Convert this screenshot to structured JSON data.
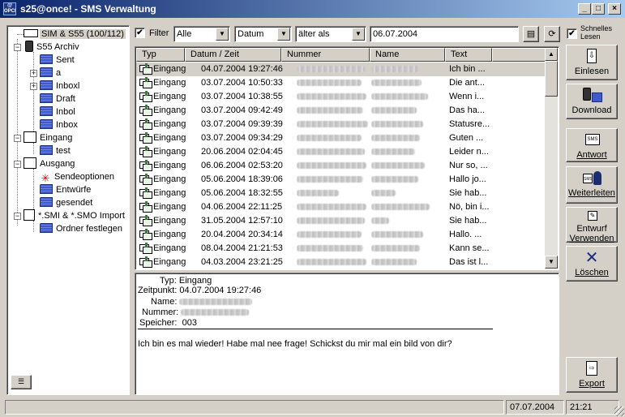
{
  "window": {
    "title": "s25@once!  -  SMS Verwaltung",
    "app_icon_text": "@ OPCE!",
    "minimize": "_",
    "maximize": "□",
    "close": "×"
  },
  "tree": {
    "items": [
      {
        "label": "SIM & S55 (100/112)",
        "icon": "sim-card-icon",
        "selected": true
      },
      {
        "label": "S55 Archiv",
        "icon": "phone-icon",
        "expander": "−"
      },
      {
        "label": "Sent",
        "icon": "folder-icon"
      },
      {
        "label": "a",
        "icon": "folder-icon",
        "expander": "+"
      },
      {
        "label": "Inboxl",
        "icon": "folder-icon",
        "expander": "+"
      },
      {
        "label": "Draft",
        "icon": "folder-icon"
      },
      {
        "label": "Inbol",
        "icon": "folder-icon"
      },
      {
        "label": "Inbox",
        "icon": "folder-icon"
      },
      {
        "label": "Eingang",
        "icon": "inbox-icon",
        "expander": "−"
      },
      {
        "label": "test",
        "icon": "folder-icon"
      },
      {
        "label": "Ausgang",
        "icon": "sms-outbox-icon",
        "expander": "−"
      },
      {
        "label": "Sendeoptionen",
        "icon": "star-icon"
      },
      {
        "label": "Entwürfe",
        "icon": "folder-icon"
      },
      {
        "label": "gesendet",
        "icon": "folder-icon"
      },
      {
        "label": "*.SMI & *.SMO Import",
        "icon": "import-icon",
        "expander": "−"
      },
      {
        "label": "Ordner festlegen",
        "icon": "folder-settings-icon"
      }
    ]
  },
  "filter": {
    "checkbox_checked": true,
    "label": "Filter",
    "type_value": "Alle",
    "field_value": "Datum",
    "op_value": "älter als",
    "date_value": "06.07.2004",
    "fast_read_checked": true,
    "fast_read_label_1": "Schnelles",
    "fast_read_label_2": "Lesen"
  },
  "list": {
    "columns": [
      "Typ",
      "Datum / Zeit",
      "Nummer",
      "Name",
      "Text"
    ],
    "rows": [
      {
        "typ": "Eingang",
        "datum": "04.07.2004  19:27:46",
        "text": "Ich bin ...",
        "selected": true
      },
      {
        "typ": "Eingang",
        "datum": "03.07.2004  10:50:33",
        "text": "Die ant..."
      },
      {
        "typ": "Eingang",
        "datum": "03.07.2004  10:38:55",
        "text": "Wenn i..."
      },
      {
        "typ": "Eingang",
        "datum": "03.07.2004  09:42:49",
        "text": "Das ha..."
      },
      {
        "typ": "Eingang",
        "datum": "03.07.2004  09:39:39",
        "text": "Statusre..."
      },
      {
        "typ": "Eingang",
        "datum": "03.07.2004  09:34:29",
        "text": "Guten ..."
      },
      {
        "typ": "Eingang",
        "datum": "20.06.2004  02:04:45",
        "text": "Leider n..."
      },
      {
        "typ": "Eingang",
        "datum": "06.06.2004  02:53:20",
        "text": "Nur so, ..."
      },
      {
        "typ": "Eingang",
        "datum": "05.06.2004  18:39:06",
        "text": "Hallo jo..."
      },
      {
        "typ": "Eingang",
        "datum": "05.06.2004  18:32:55",
        "text": "Sie hab..."
      },
      {
        "typ": "Eingang",
        "datum": "04.06.2004  22:11:25",
        "text": "Nö, bin i..."
      },
      {
        "typ": "Eingang",
        "datum": "31.05.2004  12:57:10",
        "text": "Sie hab..."
      },
      {
        "typ": "Eingang",
        "datum": "20.04.2004  20:34:14",
        "text": "Hallo. ..."
      },
      {
        "typ": "Eingang",
        "datum": "08.04.2004  21:21:53",
        "text": "Kann se..."
      },
      {
        "typ": "Eingang",
        "datum": "04.03.2004  23:21:25",
        "text": "Das ist l..."
      }
    ]
  },
  "detail": {
    "typ_label": "Typ:",
    "typ_value": "Eingang",
    "zeit_label": "Zeitpunkt:",
    "zeit_value": "04.07.2004  19:27:46",
    "name_label": "Name:",
    "nummer_label": "Nummer:",
    "speicher_label": "Speicher:",
    "speicher_value": "003",
    "body": "Ich bin es mal wieder! Habe mal nee frage! Schickst du mir mal ein bild von dir?"
  },
  "buttons": {
    "einlesen": "Einlesen",
    "download": "Download",
    "antwort": "Antwort",
    "weiterleiten": "Weiterleiten",
    "entwurf_1": "Entwurf",
    "entwurf_2": "Verwenden",
    "loeschen": "Löschen",
    "export": "Export",
    "sms_tag": "SMS"
  },
  "status": {
    "date": "07.07.2004",
    "time": "21:21"
  }
}
